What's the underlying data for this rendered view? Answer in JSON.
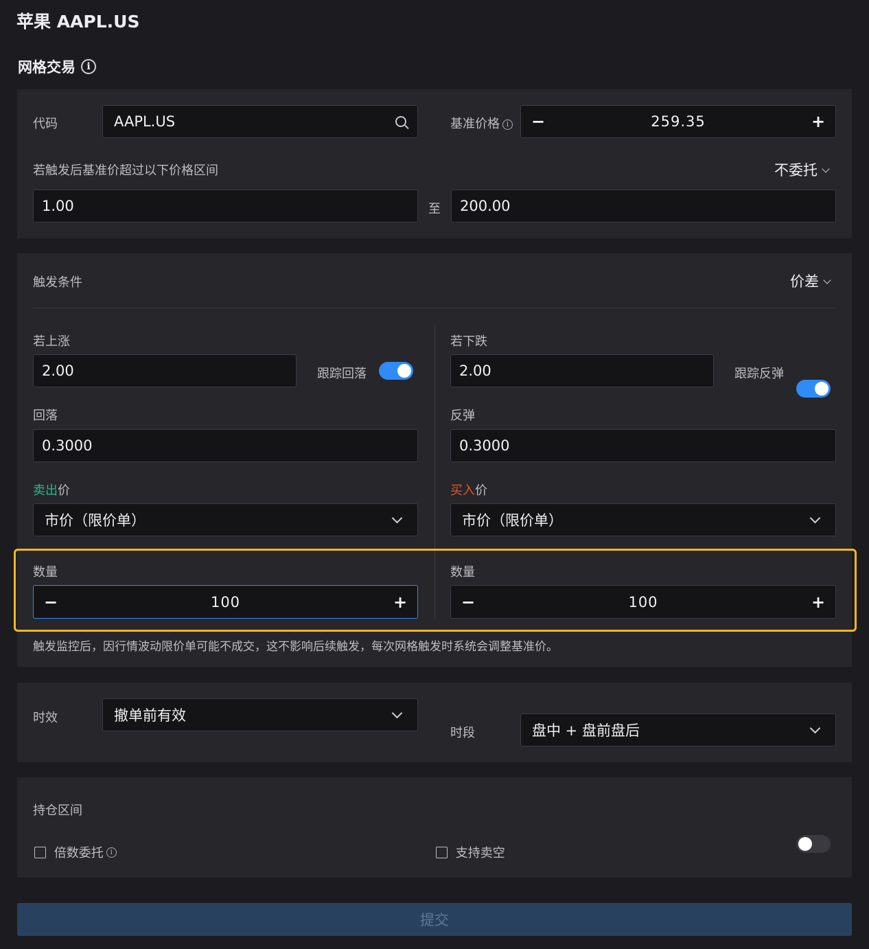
{
  "header": {
    "title": "苹果 AAPL.US"
  },
  "grid": {
    "title": "网格交易",
    "info_glyph": "i"
  },
  "basic": {
    "code_label": "代码",
    "code_value": "AAPL.US",
    "base_price_label": "基准价格",
    "base_price_value": "259.35",
    "range_label": "若触发后基准价超过以下价格区间",
    "range_action": "不委托",
    "range_min": "1.00",
    "range_to": "至",
    "range_max": "200.00"
  },
  "trigger": {
    "label": "触发条件",
    "mode": "价差",
    "rise": {
      "label": "若上涨",
      "value": "2.00",
      "track_label": "跟踪回落",
      "track_on": true,
      "pullback_label": "回落",
      "pullback_value": "0.3000",
      "price_label_colored": "卖出",
      "price_label_suffix": "价",
      "price_type": "市价（限价单）",
      "qty_label": "数量",
      "qty_value": "100"
    },
    "fall": {
      "label": "若下跌",
      "value": "2.00",
      "track_label": "跟踪反弹",
      "track_on": true,
      "rebound_label": "反弹",
      "rebound_value": "0.3000",
      "price_label_colored": "买入",
      "price_label_suffix": "价",
      "price_type": "市价（限价单）",
      "qty_label": "数量",
      "qty_value": "100"
    },
    "note": "触发监控后，因行情波动限价单可能不成交，这不影响后续触发，每次网格触发时系统会调整基准价。"
  },
  "validity": {
    "label": "时效",
    "value": "撤单前有效",
    "session_label": "时段",
    "session_value": "盘中 + 盘前盘后"
  },
  "position": {
    "label": "持仓区间",
    "toggle_on": false,
    "multiple_label": "倍数委托",
    "short_label": "支持卖空"
  },
  "submit_label": "提交",
  "colors": {
    "accent": "#2f8bf5",
    "sell": "#2bb98a",
    "buy": "#e8542f",
    "highlight": "#f5b81c"
  }
}
